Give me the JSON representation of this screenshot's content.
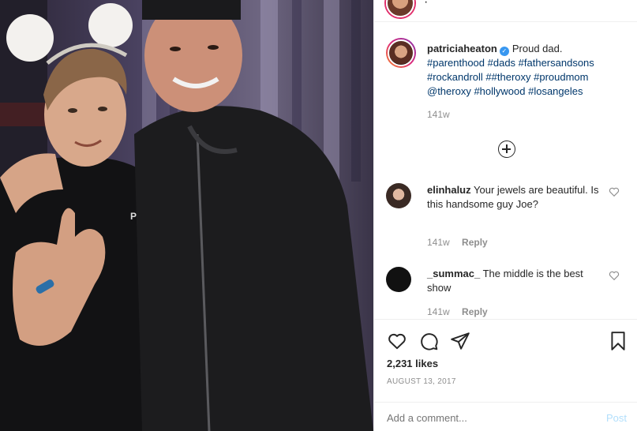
{
  "post": {
    "username": "patriciaheaton",
    "caption_text": "Proud dad.",
    "hashtags_line1": "#parenthood #dads #fathersandsons",
    "hashtags_line2": "#rockandroll ##theroxy #proudmom",
    "hashtags_line3": "@theroxy #hollywood #losangeles",
    "caption_age": "141w",
    "shirt_text": "PRO"
  },
  "comments": [
    {
      "username": "elinhaluz",
      "text": "Your jewels are beautiful. Is this handsome guy Joe?",
      "age": "141w",
      "reply_label": "Reply"
    },
    {
      "username": "_summac_",
      "text": "The middle is the best show",
      "age": "141w",
      "reply_label": "Reply"
    }
  ],
  "footer": {
    "likes": "2,231 likes",
    "date": "AUGUST 13, 2017",
    "add_comment_placeholder": "Add a comment...",
    "post_label": "Post"
  },
  "icons": [
    "heart-icon",
    "comment-icon",
    "share-icon",
    "bookmark-icon",
    "load-more-icon",
    "verified-icon"
  ],
  "colors": {
    "hashtag": "#00376b",
    "verified": "#3897f0",
    "muted": "#8e8e8e",
    "post_disabled": "#b2dffc"
  }
}
